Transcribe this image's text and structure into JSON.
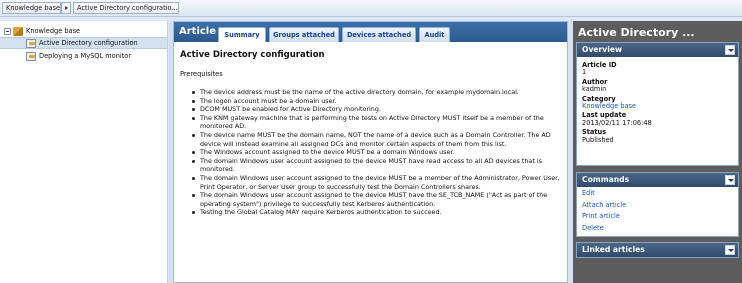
{
  "breadcrumb": {
    "items": [
      "Knowledge base",
      "Active Directory configuratio..."
    ]
  },
  "tree": {
    "root_label": "Knowledge base",
    "items": [
      "Active Directory configuration",
      "Deploying a MySQL monitor"
    ]
  },
  "article": {
    "panel_title": "Article",
    "tabs": [
      "Summary",
      "Groups attached",
      "Devices attached",
      "Audit"
    ],
    "heading": "Active Directory configuration",
    "subheading": "Prerequisites",
    "bullets": [
      "The device address must be the name of the active directory domain, for example mydomain.local.",
      "The logon account must be a domain user.",
      "DCOM MUST be enabled for Active Directory monitoring.",
      "The KNM gateway machine that is performing the tests on Active Directory MUST itself be a member of the monitored AD.",
      "The device name MUST be the domain name, NOT the name of a device such as a Domain Controller. The AD device will instead examine all assigned DCs and monitor certain aspects of them from this list.",
      "The Windows account assigned to the device MUST be a domain Windows user.",
      "The domain Windows user account assigned to the device MUST have read access to all AD devices that is monitored.",
      "The domain Windows user account assigned to the device MUST be a member of the Administrator, Power User, Print Operator, or Server User group to successfully test the Domain Controllers shares.",
      "The domain Windows user account assigned to the device MUST have the SE_TCB_NAME (\"Act as part of the operating system\") privilege to successfully test Kerberos authentication.",
      "Testing the Global Catalog MAY require Kerberos authentication to succeed."
    ]
  },
  "sidebar": {
    "title": "Active Directory ...",
    "overview": {
      "header": "Overview",
      "article_id_label": "Article ID",
      "article_id": "1",
      "author_label": "Author",
      "author": "kadmin",
      "category_label": "Category",
      "category": "Knowledge base",
      "last_update_label": "Last update",
      "last_update": "2013/02/11 17:06:48",
      "status_label": "Status",
      "status": "Published"
    },
    "commands": {
      "header": "Commands",
      "items": [
        "Edit",
        "Attach article",
        "Print article",
        "Delete"
      ]
    },
    "linked": {
      "header": "Linked articles"
    }
  }
}
